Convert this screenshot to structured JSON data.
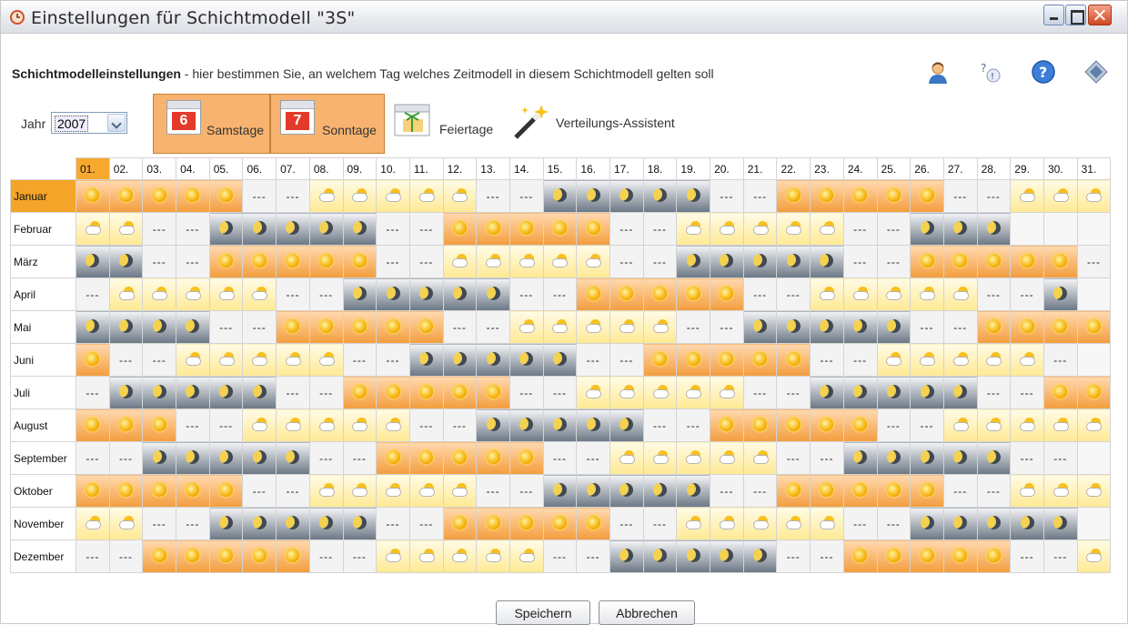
{
  "window": {
    "title": "Einstellungen für Schichtmodell \"3S\""
  },
  "header": {
    "bold": "Schichtmodelleinstellungen",
    "rest": " - hier bestimmen Sie, an welchem Tag welches Zeitmodell in diesem Schichtmodell gelten soll"
  },
  "header_icons": [
    "user-icon",
    "help-context-icon",
    "help-icon",
    "settings-icon"
  ],
  "year": {
    "label": "Jahr",
    "value": "2007"
  },
  "toolbar": {
    "samstage": {
      "label": "Samstage",
      "number": "6"
    },
    "sonntage": {
      "label": "Sonntage",
      "number": "7"
    },
    "feiertage": {
      "label": "Feiertage"
    },
    "assistent": {
      "label": "Verteilungs-Assistent"
    }
  },
  "legend_codes": {
    "F": "sun-cloud-icon",
    "S": "sun-icon",
    "N": "moon-icon",
    "D": "---",
    "E": "empty"
  },
  "days": [
    "01.",
    "02.",
    "03.",
    "04.",
    "05.",
    "06.",
    "07.",
    "08.",
    "09.",
    "10.",
    "11.",
    "12.",
    "13.",
    "14.",
    "15.",
    "16.",
    "17.",
    "18.",
    "19.",
    "20.",
    "21.",
    "22.",
    "23.",
    "24.",
    "25.",
    "26.",
    "27.",
    "28.",
    "29.",
    "30.",
    "31."
  ],
  "dash": "---",
  "months": [
    {
      "name": "Januar",
      "days": "SSSSSDDFFFFFDDNNNNNDDSSSSSDDFFF"
    },
    {
      "name": "Februar",
      "days": "FFDDNNNNNDDSSSSSDDFFFFFDDNNNEEE"
    },
    {
      "name": "März",
      "days": "NNDDSSSSSDDFFFFFDDNNNNNDDSSSSSD"
    },
    {
      "name": "April",
      "days": "DFFFFFDDNNNNNDDSSSSSDDFFFFFDDNE"
    },
    {
      "name": "Mai",
      "days": "NNNNDDSSSSSDDFFFFFDDNNNNNDDSSSS"
    },
    {
      "name": "Juni",
      "days": "SDDFFFFFDDNNNNNDDSSSSSDDFFFFFDE"
    },
    {
      "name": "Juli",
      "days": "DNNNNNDDSSSSSDDFFFFFDDNNNNNDDSS"
    },
    {
      "name": "August",
      "days": "SSSDDFFFFFDDNNNNNDDSSSSSDDFFFFF"
    },
    {
      "name": "September",
      "days": "DDNNNNNDDSSSSSDDFFFFFDDNNNNNDDE"
    },
    {
      "name": "Oktober",
      "days": "SSSSSDDFFFFFDDNNNNNDDSSSSSDDFFF"
    },
    {
      "name": "November",
      "days": "FFDDNNNNNDDSSSSSDDFFFFFDDNNNNNE"
    },
    {
      "name": "Dezember",
      "days": "DDSSSSSDDFFFFFDDNNNNNDDSSSSSDDF"
    }
  ],
  "buttons": {
    "save": "Speichern",
    "cancel": "Abbrechen"
  }
}
